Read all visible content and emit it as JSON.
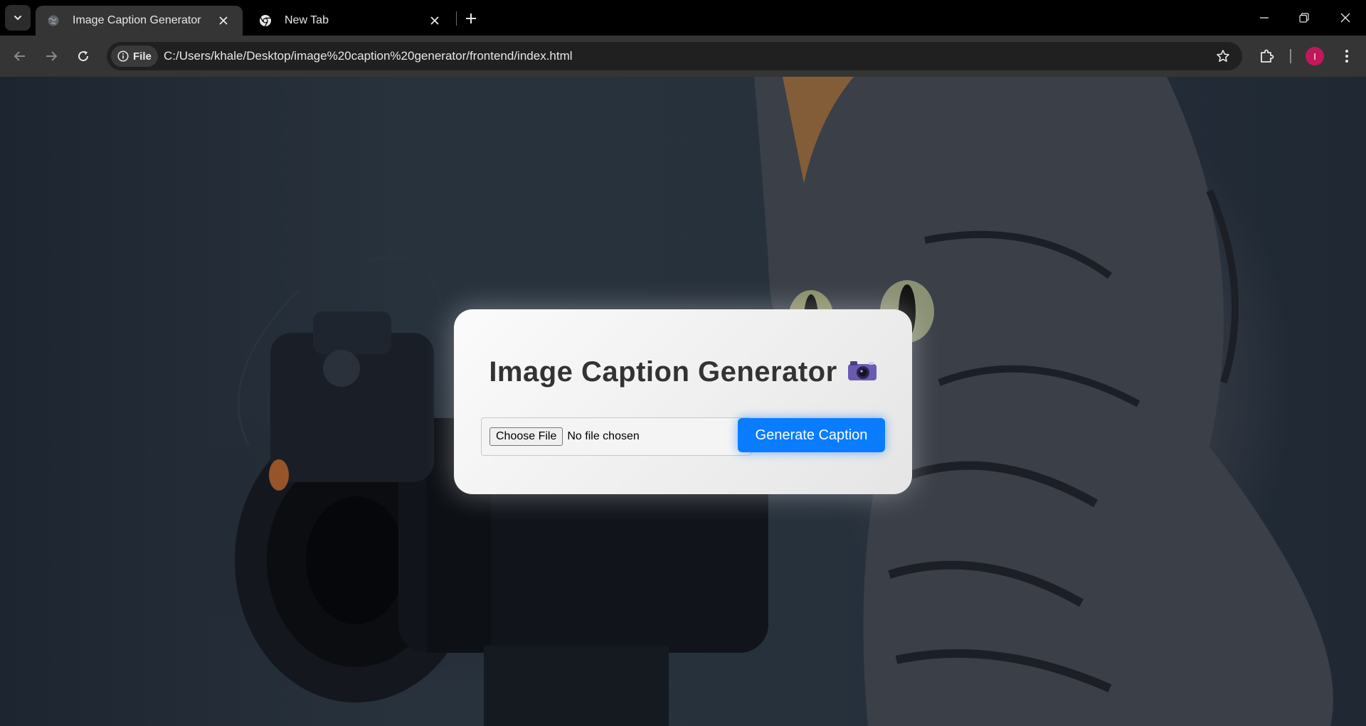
{
  "browser": {
    "tabs": [
      {
        "title": "Image Caption Generator",
        "active": true
      },
      {
        "title": "New Tab",
        "active": false
      }
    ],
    "site_chip": "File",
    "url": "C:/Users/khale/Desktop/image%20caption%20generator/frontend/index.html",
    "avatar_initial": "I",
    "colors": {
      "avatar": "#c2185b",
      "toolbar": "#353535",
      "tabbar": "#000000"
    }
  },
  "page": {
    "title": "Image Caption Generator",
    "title_emoji": "camera-icon",
    "file_input": {
      "button_label": "Choose File",
      "status": "No file chosen"
    },
    "generate_button": "Generate Caption",
    "colors": {
      "accent": "#0a7cff",
      "title": "#333333"
    }
  }
}
